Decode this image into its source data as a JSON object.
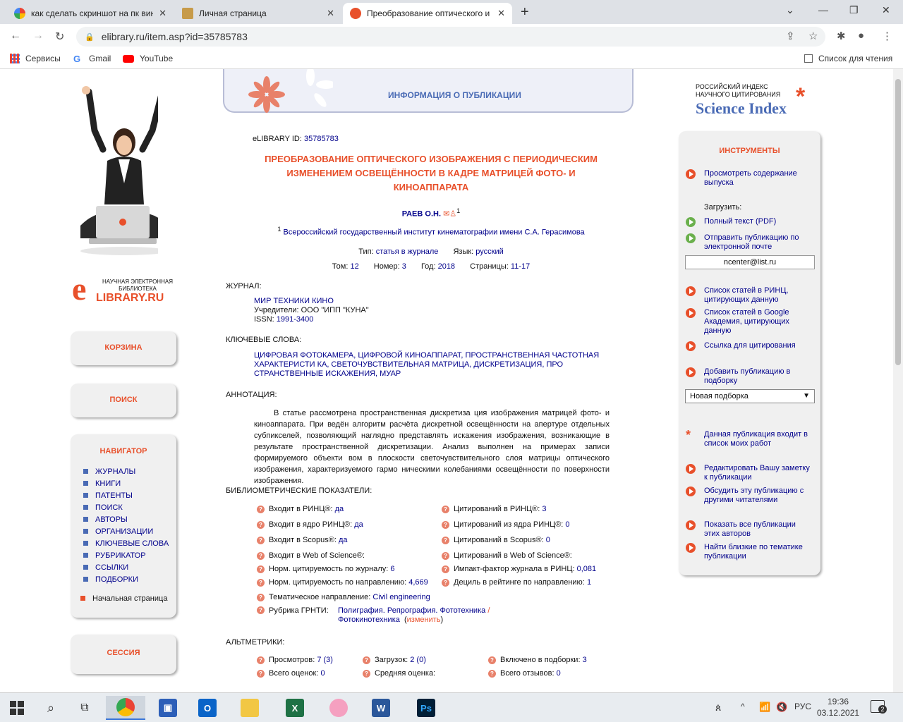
{
  "browser": {
    "tabs": [
      {
        "title": "как сделать скриншот на пк вин",
        "icon": "google-icon"
      },
      {
        "title": "Личная страница",
        "icon": "elibrary-icon"
      },
      {
        "title": "Преобразование оптического и",
        "icon": "elibrary-icon",
        "active": true
      }
    ],
    "url": "elibrary.ru/item.asp?id=35785783",
    "bookmarks": [
      "Сервисы",
      "Gmail",
      "YouTube"
    ],
    "reading_list": "Список для чтения"
  },
  "left": {
    "logo_text_1": "НАУЧНАЯ ЭЛЕКТРОННАЯ",
    "logo_text_2": "БИБЛИОТЕКА",
    "logo_main": "LIBRARY.RU",
    "cart": "КОРЗИНА",
    "search": "ПОИСК",
    "navigator": "НАВИГАТОР",
    "nav_items": [
      "ЖУРНАЛЫ",
      "КНИГИ",
      "ПАТЕНТЫ",
      "ПОИСК",
      "АВТОРЫ",
      "ОРГАНИЗАЦИИ",
      "КЛЮЧЕВЫЕ СЛОВА",
      "РУБРИКАТОР",
      "ССЫЛКИ",
      "ПОДБОРКИ"
    ],
    "home": "Начальная страница",
    "session": "СЕССИЯ"
  },
  "main": {
    "banner_title": "ИНФОРМАЦИЯ О ПУБЛИКАЦИИ",
    "id_label": "eLIBRARY ID:",
    "id_value": "35785783",
    "title": "ПРЕОБРАЗОВАНИЕ ОПТИЧЕСКОГО ИЗОБРАЖЕНИЯ С ПЕРИОДИЧЕСКИМ ИЗМЕНЕНИЕМ ОСВЕЩЁННОСТИ В КАДРЕ МАТРИЦЕЙ ФОТО- И КИНОАППАРАТА",
    "author": "РАЕВ О.Н.",
    "author_sup": "1",
    "affil_sup": "1",
    "affiliation": "Всероссийский государственный институт кинематографии имени С.А. Герасимова",
    "type_label": "Тип:",
    "type_value": "статья в журнале",
    "lang_label": "Язык:",
    "lang_value": "русский",
    "vol_label": "Том:",
    "vol_value": "12",
    "num_label": "Номер:",
    "num_value": "3",
    "year_label": "Год:",
    "year_value": "2018",
    "pages_label": "Страницы:",
    "pages_value": "11-17",
    "journal_label": "ЖУРНАЛ:",
    "journal_name": "МИР ТЕХНИКИ КИНО",
    "founder": "Учредители: ООО \"ИПП \"КУНА\"",
    "issn_label": "ISSN:",
    "issn_value": "1991-3400",
    "keywords_label": "КЛЮЧЕВЫЕ СЛОВА:",
    "keywords": "ЦИФРОВАЯ ФОТОКАМЕРА, ЦИФРОВОЙ КИНОАППАРАТ, ПРОСТРАНСТВЕННАЯ ЧАСТОТНАЯ ХАРАКТЕРИСТИ КА, СВЕТОЧУВСТВИТЕЛЬНАЯ МАТРИЦА, ДИСКРЕТИЗАЦИЯ, ПРО СТРАНСТВЕННЫЕ ИСКАЖЕНИЯ, МУАР",
    "annotation_label": "АННОТАЦИЯ:",
    "annotation": "В статье рассмотрена пространственная дискретиза ция изображения матрицей фото- и киноаппарата. При ведён алгоритм расчёта дискретной освещённости на апертуре отдельных субпикселей, позволяющий наглядно представлять искажения изображения, возникающие в результате пространственной дискретизации. Анализ выполнен на примерах записи формируемого объекти вом в плоскости светочувствительного слоя матрицы оптического изображения, характеризуемого гармо ническими колебаниями освещённости по поверхности изображения.",
    "biblio_label": "БИБЛИОМЕТРИЧЕСКИЕ ПОКАЗАТЕЛИ:",
    "biblio_left": [
      {
        "label": "Входит в РИНЦ®:",
        "value": "да"
      },
      {
        "label": "Входит в ядро РИНЦ®:",
        "value": "да"
      },
      {
        "label": "Входит в Scopus®:",
        "value": "да"
      },
      {
        "label": "Входит в Web of Science®:",
        "value": ""
      },
      {
        "label": "Норм. цитируемость по журналу:",
        "value": "6"
      },
      {
        "label": "Норм. цитируемость по направлению:",
        "value": "4,669"
      },
      {
        "label": "Тематическое направление:",
        "value": "Civil engineering"
      }
    ],
    "biblio_right": [
      {
        "label": "Цитирований в РИНЦ®:",
        "value": "3"
      },
      {
        "label": "Цитирований из ядра РИНЦ®:",
        "value": "0"
      },
      {
        "label": "Цитирований в Scopus®:",
        "value": "0"
      },
      {
        "label": "Цитирований в Web of Science®:",
        "value": ""
      },
      {
        "label": "Импакт-фактор журнала в РИНЦ:",
        "value": "0,081"
      },
      {
        "label": "Дециль в рейтинге по направлению:",
        "value": "1"
      }
    ],
    "grnti_label": "Рубрика ГРНТИ:",
    "grnti_value_1": "Полиграфия. Репрография. Фототехника",
    "grnti_sep": "/",
    "grnti_value_2": "Фотокинотехника",
    "grnti_change": "изменить",
    "altmetrics_label": "АЛЬТМЕТРИКИ:",
    "alt": [
      {
        "label": "Просмотров:",
        "value": "7 (3)"
      },
      {
        "label": "Загрузок:",
        "value": "2 (0)"
      },
      {
        "label": "Включено в подборки:",
        "value": "3"
      },
      {
        "label": "Всего оценок:",
        "value": "0"
      },
      {
        "label": "Средняя оценка:",
        "value": ""
      },
      {
        "label": "Всего отзывов:",
        "value": "0"
      }
    ]
  },
  "right": {
    "sci_line1": "РОССИЙСКИЙ ИНДЕКС",
    "sci_line2": "НАУЧНОГО ЦИТИРОВАНИЯ",
    "sci_main": "Science Index",
    "tools_title": "ИНСТРУМЕНТЫ",
    "view_issue": "Просмотреть содержание выпуска",
    "download_label": "Загрузить:",
    "fulltext": "Полный текст (PDF)",
    "email_send": "Отправить публикацию по электронной почте",
    "email_value": "ncenter@list.ru",
    "rinc_cite": "Список статей в РИНЦ, цитирующих данную",
    "google_cite": "Список статей в Google Академия, цитирующих данную",
    "cite_link": "Ссылка для цитирования",
    "add_collection": "Добавить публикацию в подборку",
    "collection_select": "Новая подборка",
    "my_works": "Данная публикация входит в список моих работ",
    "edit_note": "Редактировать Вашу заметку к публикации",
    "discuss": "Обсудить эту публикацию с другими читателями",
    "show_all": "Показать все публикации этих авторов",
    "similar": "Найти близкие по тематике публикации"
  },
  "taskbar": {
    "lang": "РУС",
    "time": "19:36",
    "date": "03.12.2021",
    "notif": "2"
  },
  "colors": {
    "accent": "#e8502b",
    "link": "#00008b",
    "banner": "#4a6bb5"
  }
}
